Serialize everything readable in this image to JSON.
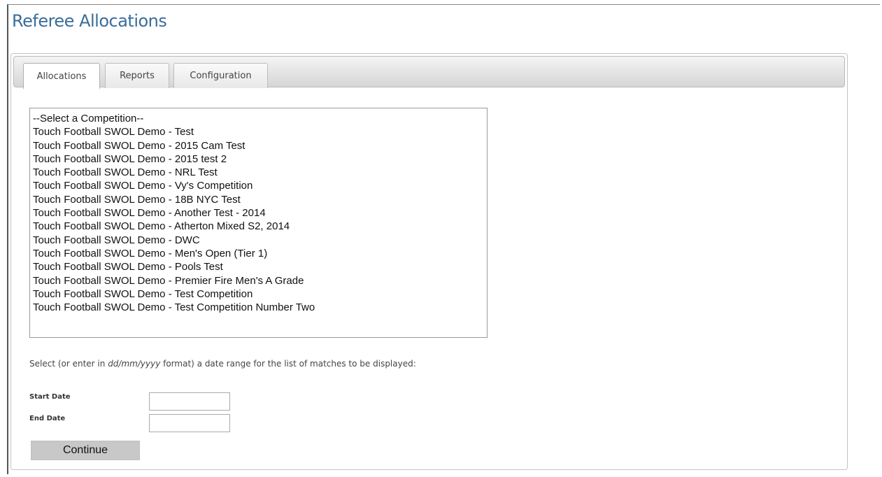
{
  "page": {
    "title": "Referee Allocations"
  },
  "tabs": [
    {
      "label": "Allocations",
      "active": true
    },
    {
      "label": "Reports",
      "active": false
    },
    {
      "label": "Configuration",
      "active": false
    }
  ],
  "competitions": {
    "options": [
      "--Select a Competition--",
      "Touch Football SWOL Demo - Test",
      "Touch Football SWOL Demo - 2015 Cam Test",
      "Touch Football SWOL Demo - 2015 test 2",
      "Touch Football SWOL Demo - NRL Test",
      "Touch Football SWOL Demo - Vy's Competition",
      "Touch Football SWOL Demo - 18B NYC Test",
      "Touch Football SWOL Demo - Another Test - 2014",
      "Touch Football SWOL Demo - Atherton Mixed S2, 2014",
      "Touch Football SWOL Demo - DWC",
      "Touch Football SWOL Demo - Men's Open (Tier 1)",
      "Touch Football SWOL Demo - Pools Test",
      "Touch Football SWOL Demo - Premier Fire Men's A Grade",
      "Touch Football SWOL Demo - Test Competition",
      "Touch Football SWOL Demo - Test Competition Number Two"
    ]
  },
  "date_range": {
    "instruction_prefix": "Select (or enter in ",
    "instruction_format": "dd/mm/yyyy",
    "instruction_suffix": " format) a date range for the list of matches to be displayed:",
    "start_label": "Start Date",
    "start_value": "",
    "end_label": "End Date",
    "end_value": ""
  },
  "actions": {
    "continue_label": "Continue"
  },
  "colors": {
    "title": "#3a6d9a",
    "button_bg": "#c8c8c8",
    "tabbar_bg": "#dcdcdc"
  }
}
